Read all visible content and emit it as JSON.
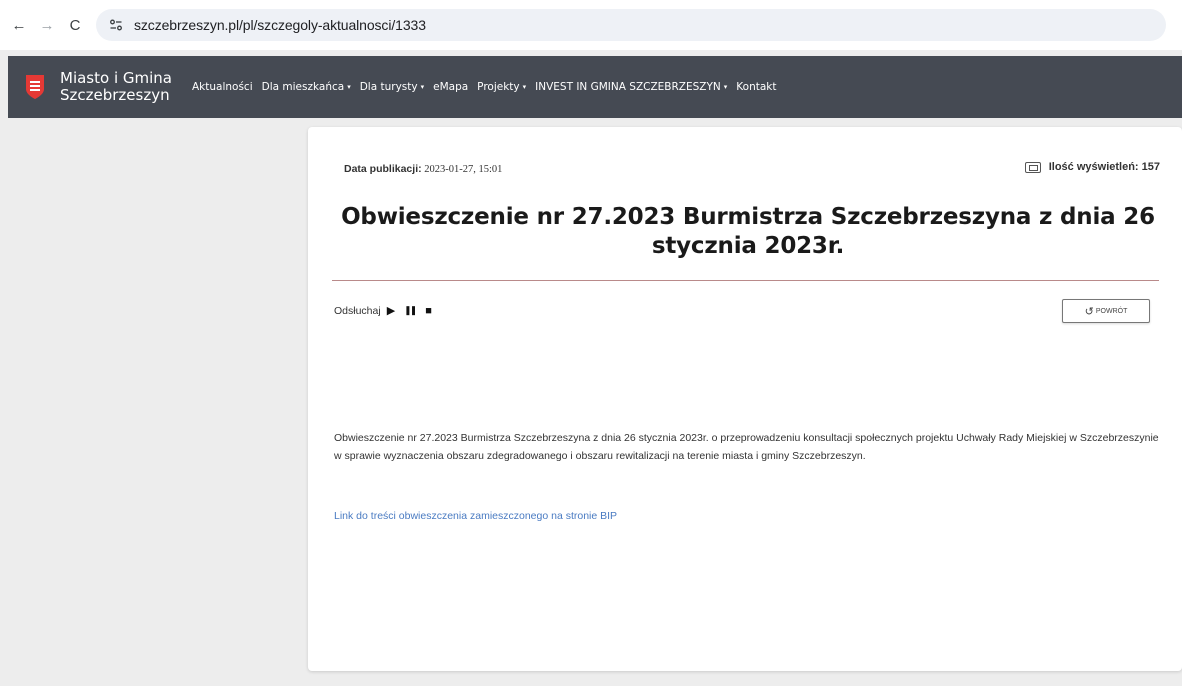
{
  "browser": {
    "url": "szczebrzeszyn.pl/pl/szczegoly-aktualnosci/1333",
    "back_glyph": "←",
    "forward_glyph": "→",
    "reload_glyph": "C"
  },
  "site": {
    "brand_line1": "Miasto i Gmina",
    "brand_line2": "Szczebrzeszyn",
    "logo_color": "#e53935",
    "menu": [
      {
        "label": "Aktualności",
        "dropdown": false
      },
      {
        "label": "Dla mieszkańca",
        "dropdown": true
      },
      {
        "label": "Dla turysty",
        "dropdown": true
      },
      {
        "label": "eMapa",
        "dropdown": false
      },
      {
        "label": "Projekty",
        "dropdown": true
      },
      {
        "label": "INVEST IN GMINA SZCZEBRZESZYN",
        "dropdown": true
      },
      {
        "label": "Kontakt",
        "dropdown": false
      }
    ],
    "caret": "▾"
  },
  "article": {
    "date_label": "Data publikacji:",
    "date_value": "2023-01-27, 15:01",
    "views_label": "Ilość wyświetleń: 157",
    "title": "Obwieszczenie nr 27.2023 Burmistrza Szczebrzeszyna z dnia 26 stycznia 2023r.",
    "listen_label": "Odsłuchaj",
    "play_glyph": "▶",
    "pause_glyph": "❚❚",
    "stop_glyph": "■",
    "back_arrow": "↺",
    "back_label": "POWRÓT",
    "body": "Obwieszczenie nr 27.2023 Burmistrza Szczebrzeszyna z dnia 26 stycznia 2023r. o przeprowadzeniu konsultacji społecznych projektu Uchwały Rady Miejskiej w Szczebrzeszynie w sprawie wyznaczenia obszaru zdegradowanego i obszaru rewitalizacji na terenie miasta i gminy Szczebrzeszyn.",
    "link_text": "Link do treści obwieszczenia zamieszczonego na stronie BIP"
  }
}
